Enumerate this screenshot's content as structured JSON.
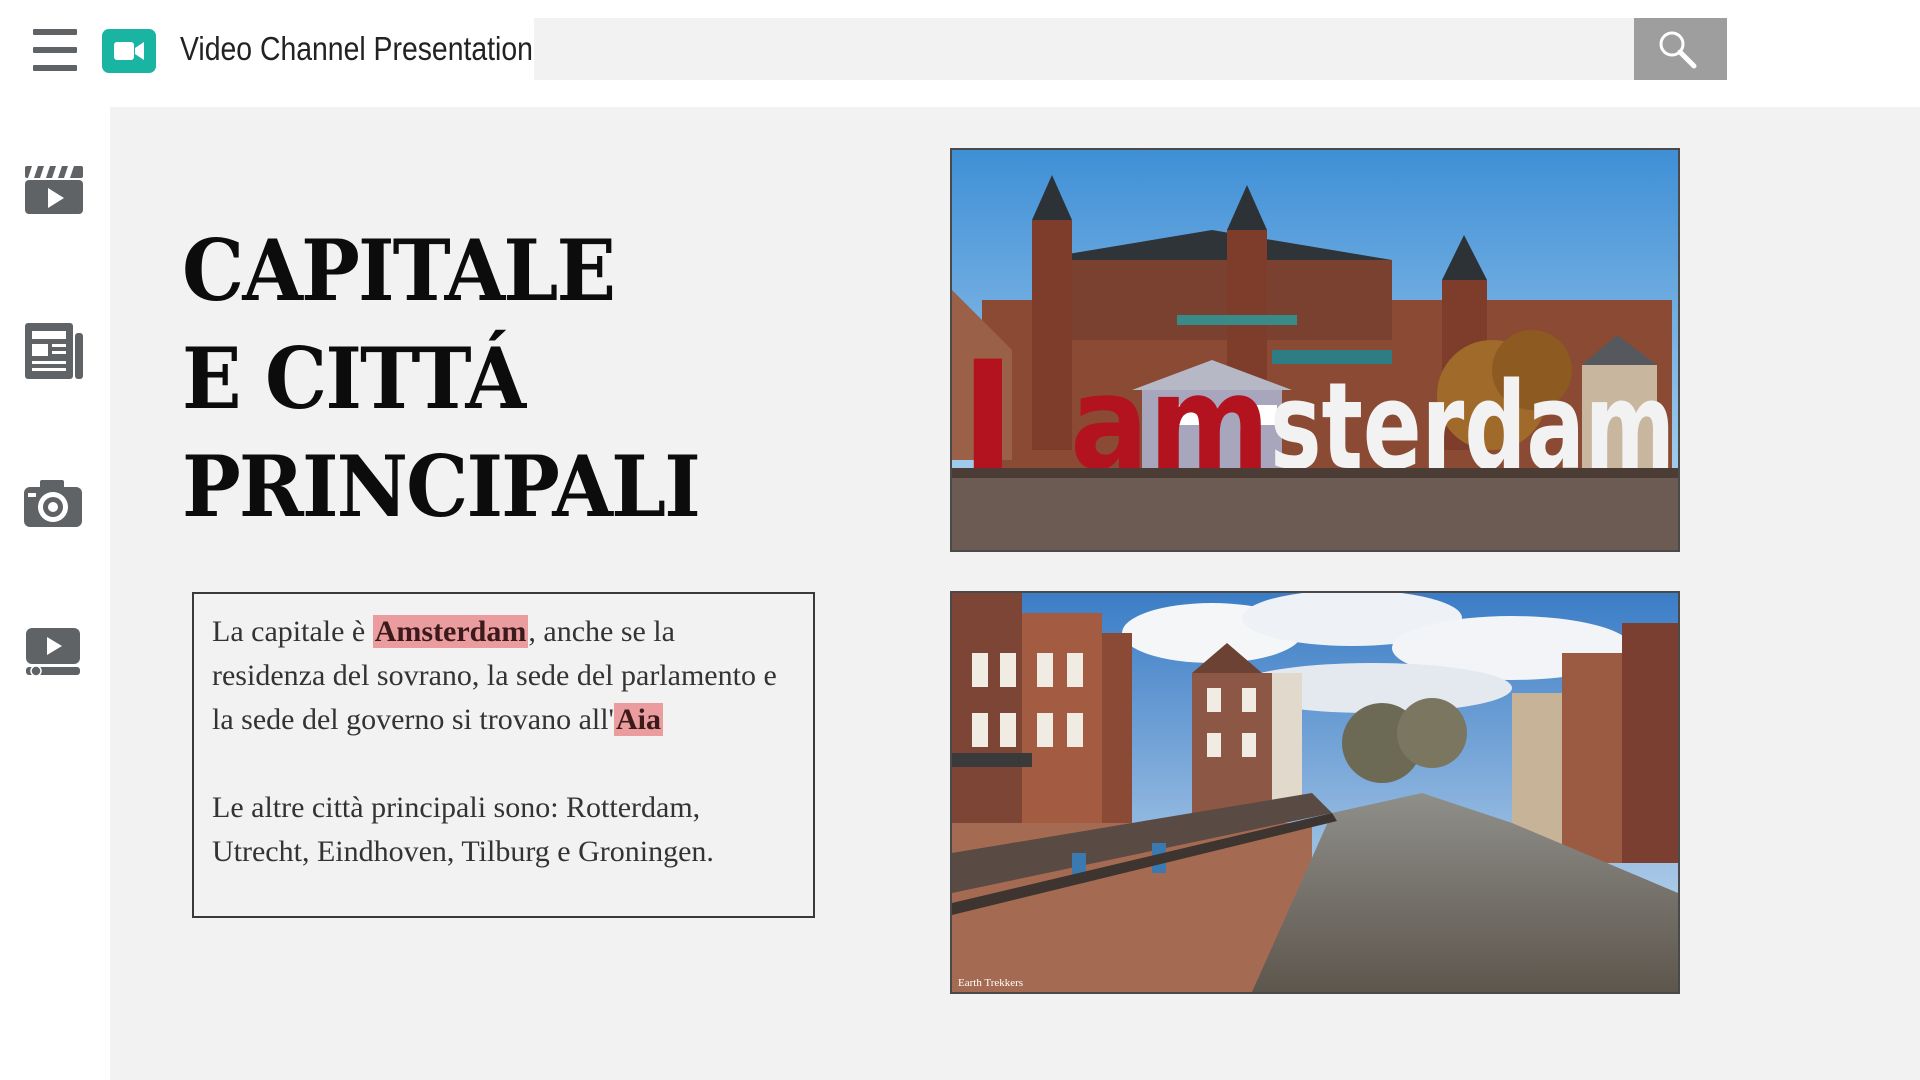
{
  "header": {
    "app_title": "Video Channel Presentation",
    "search": {
      "value": "",
      "placeholder": ""
    },
    "icons": {
      "menu": "hamburger-menu-icon",
      "logo": "video-camera-icon",
      "search": "magnifier-icon"
    }
  },
  "sidebar": {
    "items": [
      {
        "icon": "clapperboard-icon"
      },
      {
        "icon": "newspaper-icon"
      },
      {
        "icon": "camera-icon"
      },
      {
        "icon": "play-screen-icon"
      }
    ]
  },
  "slide": {
    "title_lines": [
      "CAPITALE",
      "E CITTÁ",
      "PRINCIPALI"
    ],
    "paragraph1": {
      "part1": "La capitale è ",
      "highlight1": "Amsterdam",
      "part2": ", anche se la residenza del sovrano, la sede del parlamento e la sede del governo si trovano all'",
      "highlight2": "Aia"
    },
    "paragraph2": "Le altre città principali sono: Rotterdam, Utrecht, Eindhoven, Tilburg e Groningen.",
    "photo1": {
      "sign_prefix": "I",
      "sign_red": "am",
      "sign_white": "sterdam"
    },
    "photo2": {
      "credit": "Earth Trekkers"
    }
  },
  "colors": {
    "brand": "#19b4a2",
    "highlight": "#eb9c9f",
    "main_bg": "#f2f2f2",
    "search_button": "#9e9e9e",
    "icon_gray": "#5f6366",
    "sign_red": "#b3121f"
  }
}
